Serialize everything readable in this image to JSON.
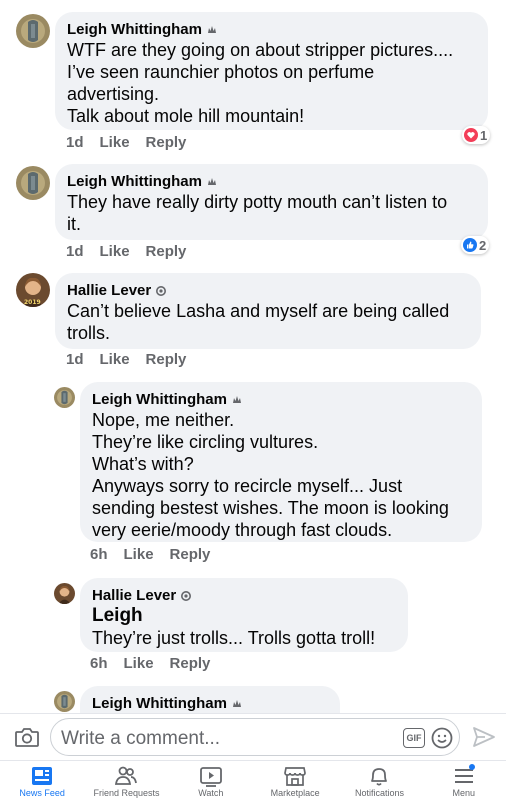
{
  "comments": [
    {
      "name": "Leigh Whittingham",
      "lines": [
        "WTF are they going on about stripper pictures....",
        "I’ve seen raunchier photos on perfume",
        "advertising.",
        "Talk about mole hill mountain!"
      ],
      "time": "1d",
      "like": "Like",
      "reply": "Reply",
      "reaction_type": "love",
      "reaction_count": "1"
    },
    {
      "name": "Leigh Whittingham",
      "lines": [
        "They have really dirty potty mouth can’t listen to",
        "it."
      ],
      "time": "1d",
      "like": "Like",
      "reply": "Reply",
      "reaction_type": "like",
      "reaction_count": "2"
    },
    {
      "name": "Hallie Lever",
      "lines": [
        "Can’t believe Lasha and myself are being called",
        "trolls."
      ],
      "time": "1d",
      "like": "Like",
      "reply": "Reply"
    }
  ],
  "replies": [
    {
      "name": "Leigh Whittingham",
      "lines": [
        "Nope, me neither.",
        "They’re like circling vultures.",
        "What’s with?",
        "Anyways sorry to recircle myself... Just",
        "sending bestest wishes. The moon is looking",
        "very eerie/moody through fast clouds."
      ],
      "time": "6h",
      "like": "Like",
      "reply": "Reply"
    },
    {
      "name": "Hallie Lever",
      "mention": "Leigh",
      "lines": [
        "They’re just trolls... Trolls gotta troll!"
      ],
      "time": "6h",
      "like": "Like",
      "reply": "Reply"
    },
    {
      "name": "Leigh Whittingham"
    }
  ],
  "composer": {
    "placeholder": "Write a comment...",
    "gif_label": "GIF"
  },
  "tabs": [
    {
      "label": "News Feed",
      "icon": "news-feed-icon",
      "active": true
    },
    {
      "label": "Friend Requests",
      "icon": "friend-requests-icon"
    },
    {
      "label": "Watch",
      "icon": "watch-icon"
    },
    {
      "label": "Marketplace",
      "icon": "marketplace-icon"
    },
    {
      "label": "Notifications",
      "icon": "notifications-icon"
    },
    {
      "label": "Menu",
      "icon": "menu-icon",
      "has_dot": true
    }
  ],
  "colors": {
    "bubble": "#f0f2f5",
    "meta_text": "#65676b",
    "accent": "#1877f2",
    "love": "#f33e58"
  }
}
